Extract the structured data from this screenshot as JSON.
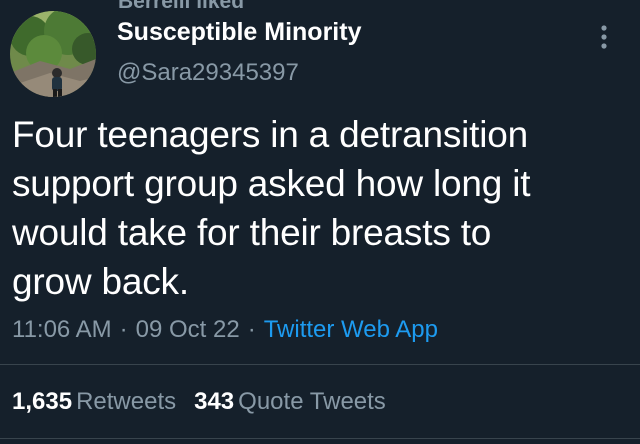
{
  "social_context": "Berrelli liked",
  "author": {
    "display_name": "Susceptible Minority",
    "handle": "@Sara29345397"
  },
  "tweet": {
    "lines": [
      "Four teenagers in a detransition",
      "support group asked how long it",
      "would take for their breasts to",
      "grow back."
    ]
  },
  "meta": {
    "time": "11:06 AM",
    "separator": "·",
    "date": "09 Oct 22",
    "source": "Twitter Web App"
  },
  "stats": {
    "retweets_count": "1,635",
    "retweets_label": "Retweets",
    "quotes_count": "343",
    "quotes_label": "Quote Tweets"
  },
  "icons": {
    "more": "more-vertical-icon",
    "avatar": "profile-photo"
  },
  "colors": {
    "background": "#15202b",
    "primary_text": "#ffffff",
    "secondary_text": "#8899a6",
    "link": "#1d9bf0",
    "divider": "#38444d"
  }
}
